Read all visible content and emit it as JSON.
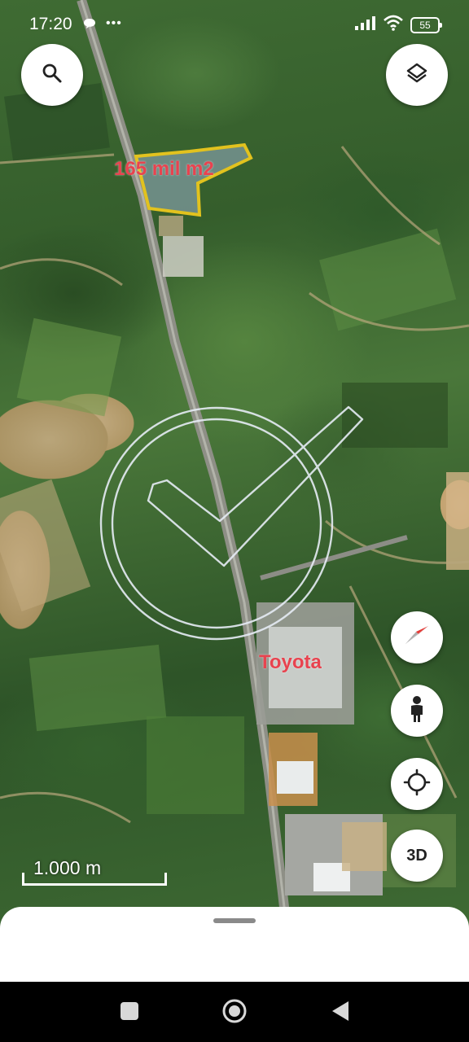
{
  "status_bar": {
    "time": "17:20",
    "notification_icons": [
      "chat-bubble-icon",
      "more-dots-icon"
    ],
    "battery_level": "55",
    "signal_icon": "cell-signal-icon",
    "wifi_icon": "wifi-icon"
  },
  "map": {
    "type": "satellite",
    "labels": {
      "plot_area": "165 mil m2",
      "factory": "Toyota"
    },
    "scale_label": "1.000 m"
  },
  "controls": {
    "search_icon": "search-icon",
    "layers_icon": "layers-icon",
    "compass_icon": "compass-icon",
    "street_view_icon": "pegman-icon",
    "my_location_icon": "my-location-icon",
    "three_d_label": "3D"
  },
  "colors": {
    "label_red": "#e8434f",
    "polygon_outline": "#e2c21e",
    "watermark": "#e6ecf5"
  },
  "nav_bar": {
    "buttons": [
      "recents-square-icon",
      "home-circle-icon",
      "back-triangle-icon"
    ]
  }
}
